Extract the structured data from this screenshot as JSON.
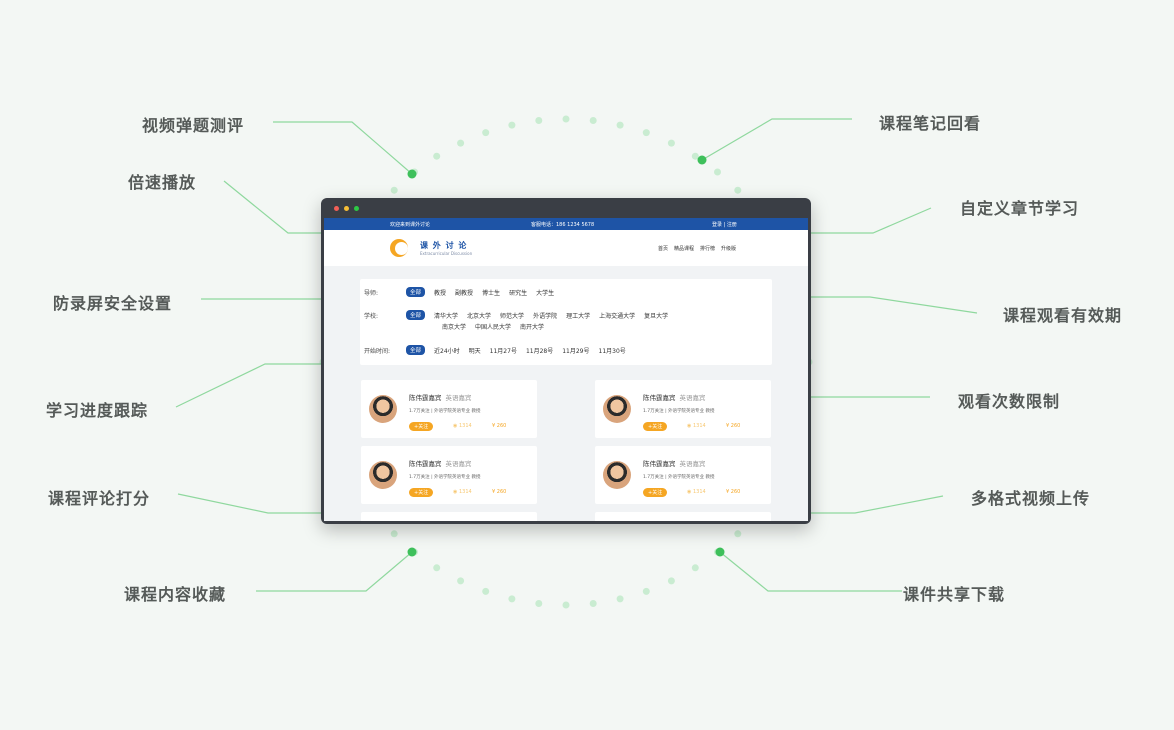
{
  "features_left": [
    "视频弹题测评",
    "倍速播放",
    "防录屏安全设置",
    "学习进度跟踪",
    "课程评论打分",
    "课程内容收藏"
  ],
  "features_right": [
    "课程笔记回看",
    "自定义章节学习",
    "课程观看有效期",
    "观看次数限制",
    "多格式视频上传",
    "课件共享下载"
  ],
  "colors": {
    "accent_green": "#3ec05b",
    "brand_blue": "#1e54a6",
    "orange": "#f5a623"
  },
  "site": {
    "topbar": {
      "welcome": "欢迎来到课外讨论",
      "phone": "客服电话：186 1234 5678",
      "login": "登录 | 注册"
    },
    "brand": {
      "name": "课 外 讨 论",
      "subtitle": "Extracurricular Discussion"
    },
    "nav": [
      "首页",
      "精品课程",
      "排行榜",
      "升级版"
    ],
    "filters": {
      "tutor": {
        "label": "导师:",
        "all": "全部",
        "options": [
          "教授",
          "副教授",
          "博士生",
          "研究生",
          "大学生"
        ]
      },
      "school": {
        "label": "学校:",
        "all": "全部",
        "options": [
          "清华大学",
          "北京大学",
          "师范大学",
          "外语学院",
          "理工大学",
          "上海交通大学",
          "复旦大学"
        ],
        "options2": [
          "南京大学",
          "中国人民大学",
          "南开大学"
        ]
      },
      "time": {
        "label": "开始时间:",
        "all": "全部",
        "options": [
          "近24小时",
          "明天",
          "11月27号",
          "11月28号",
          "11月29号",
          "11月30号"
        ]
      }
    },
    "cards": [
      {
        "name": "陈伟霆嘉宾",
        "tag": "英语嘉宾",
        "info": "1.7万关注 | 外语学院英语专业 教授",
        "follow": "+关注",
        "views": "◉ 1314",
        "price": "¥ 260"
      },
      {
        "name": "陈伟霆嘉宾",
        "tag": "英语嘉宾",
        "info": "1.7万关注 | 外语学院英语专业 教授",
        "follow": "+关注",
        "views": "◉ 1314",
        "price": "¥ 260"
      },
      {
        "name": "陈伟霆嘉宾",
        "tag": "英语嘉宾",
        "info": "1.7万关注 | 外语学院英语专业 教授",
        "follow": "+关注",
        "views": "◉ 1314",
        "price": "¥ 260"
      },
      {
        "name": "陈伟霆嘉宾",
        "tag": "英语嘉宾",
        "info": "1.7万关注 | 外语学院英语专业 教授",
        "follow": "+关注",
        "views": "◉ 1314",
        "price": "¥ 260"
      }
    ]
  }
}
